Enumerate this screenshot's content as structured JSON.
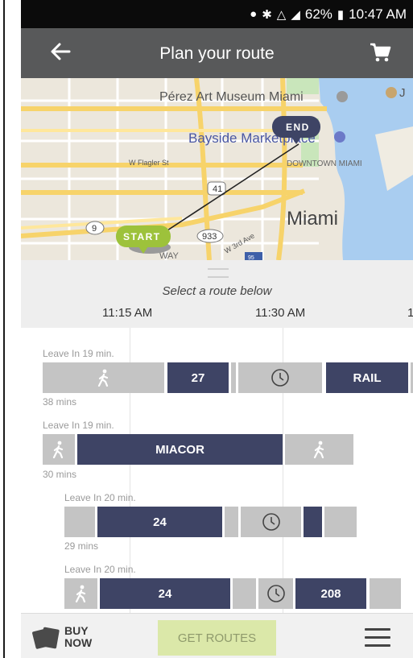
{
  "status_bar": {
    "battery": "62%",
    "time": "10:47 AM",
    "icons": [
      "location-icon",
      "bluetooth-icon",
      "wifi-icon",
      "signal-icon",
      "battery-icon"
    ]
  },
  "app_bar": {
    "title": "Plan your route",
    "back_icon": "arrow-left-icon",
    "cart_icon": "cart-icon"
  },
  "map": {
    "labels": {
      "museum": "Pérez Art Museum Miami",
      "marketplace": "Bayside Marketplace",
      "downtown": "DOWNTOWN MIAMI",
      "city": "Miami",
      "street_flagler": "W Flagler St",
      "street_3rd": "W 3rd Ave",
      "road_41": "41",
      "road_9": "9",
      "road_933": "933",
      "road_95": "95",
      "way": "WAY",
      "edge_letter": "J"
    },
    "start_label": "START",
    "end_label": "END"
  },
  "drawer": {
    "hint": "Select a route below",
    "times": [
      "11:15 AM",
      "11:30 AM",
      "1"
    ]
  },
  "routes": [
    {
      "leave": "Leave In 19 min.",
      "duration": "38 mins",
      "segments": [
        {
          "type": "walk",
          "label": ""
        },
        {
          "type": "bus",
          "label": "27"
        },
        {
          "type": "gap",
          "label": ""
        },
        {
          "type": "wait",
          "label": ""
        },
        {
          "type": "bus",
          "label": "RAIL"
        },
        {
          "type": "gap",
          "label": ""
        }
      ]
    },
    {
      "leave": "Leave In 19 min.",
      "duration": "30 mins",
      "segments": [
        {
          "type": "walk",
          "label": ""
        },
        {
          "type": "bus",
          "label": "MIACOR"
        },
        {
          "type": "walk",
          "label": ""
        }
      ]
    },
    {
      "leave": "Leave In 20 min.",
      "duration": "29 mins",
      "segments": [
        {
          "type": "gap",
          "label": ""
        },
        {
          "type": "bus",
          "label": "24"
        },
        {
          "type": "gap",
          "label": ""
        },
        {
          "type": "wait",
          "label": ""
        },
        {
          "type": "bus",
          "label": ""
        },
        {
          "type": "gap",
          "label": ""
        }
      ]
    },
    {
      "leave": "Leave In 20 min.",
      "duration": "",
      "segments": [
        {
          "type": "walk",
          "label": ""
        },
        {
          "type": "bus",
          "label": "24"
        },
        {
          "type": "gap",
          "label": ""
        },
        {
          "type": "wait",
          "label": ""
        },
        {
          "type": "bus",
          "label": "208"
        },
        {
          "type": "gap",
          "label": ""
        }
      ]
    }
  ],
  "bottom_bar": {
    "buy_now": "BUY NOW",
    "get_routes": "GET ROUTES",
    "menu_icon": "hamburger-menu-icon"
  },
  "colors": {
    "app_bar": "#58595a",
    "bus_segment": "#3e4465",
    "walk_segment": "#c4c4c4",
    "start_pin": "#9dc23b",
    "end_pin": "#3e4465",
    "get_routes_button": "#dbe8a9"
  }
}
